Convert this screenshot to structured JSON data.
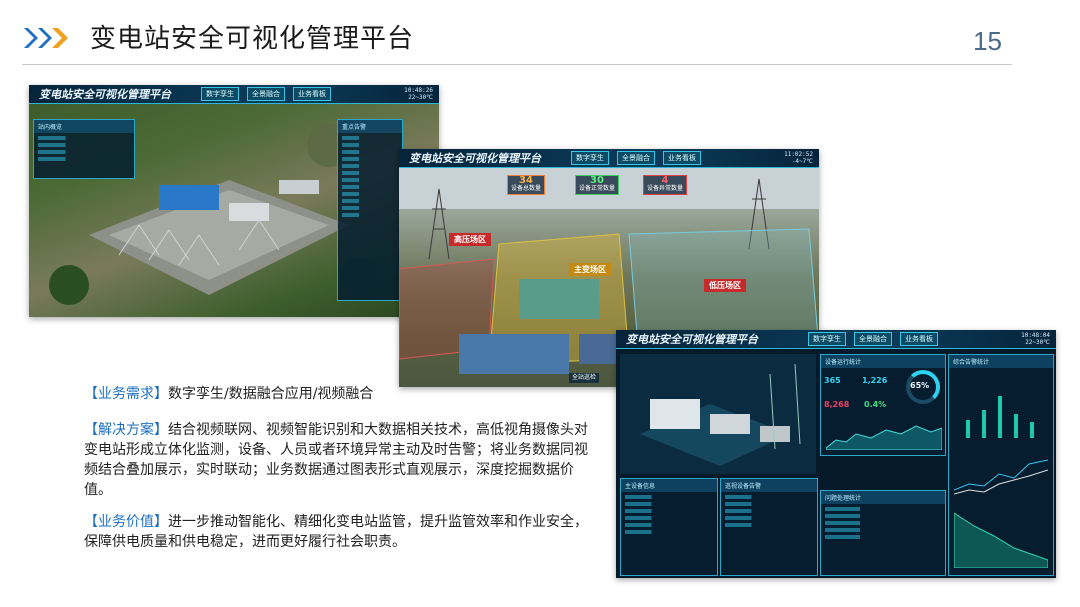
{
  "header": {
    "title": "变电站安全可视化管理平台",
    "page_number": "15",
    "accent_color": "#1e6fc0"
  },
  "screenshots": [
    {
      "title": "变电站安全可视化管理平台",
      "nav": [
        "数字孪生",
        "全景融合",
        "业务看板"
      ],
      "time": "10:48:26",
      "weather": "22~30℃",
      "panels": [
        "站内概览",
        "重点告警"
      ]
    },
    {
      "title": "变电站安全可视化管理平台",
      "nav": [
        "数字孪生",
        "全景融合",
        "业务看板"
      ],
      "time": "11:02:52",
      "weather": "-4~7℃",
      "stats": [
        {
          "value": "34",
          "label": "设备总数量"
        },
        {
          "value": "30",
          "label": "设备正常数量"
        },
        {
          "value": "4",
          "label": "设备异常数量"
        }
      ],
      "zones": [
        "高压场区",
        "主变场区",
        "低压场区"
      ],
      "footer": "全站巡检"
    },
    {
      "title": "变电站安全可视化管理平台",
      "nav": [
        "数字孪生",
        "全景融合",
        "业务看板"
      ],
      "time": "10:48:04",
      "weather": "22~30℃",
      "metrics": {
        "running_days": "365",
        "energy": "1,226",
        "load": "8,268",
        "percent": "65%",
        "rate": "0.4%"
      },
      "panel_titles": [
        "主设备信息",
        "巡视设备告警",
        "问题处理统计",
        "综合告警统计",
        "设备运行统计"
      ]
    }
  ],
  "sections": [
    {
      "label": "【业务需求】",
      "text": "数字孪生/数据融合应用/视频融合"
    },
    {
      "label": "【解决方案】",
      "text": "结合视频联网、视频智能识别和大数据相关技术，高低视角摄像头对变电站形成立体化监测，设备、人员或者环境异常主动及时告警；将业务数据同视频结合叠加展示，实时联动；业务数据通过图表形式直观展示，深度挖掘数据价值。"
    },
    {
      "label": "【业务价值】",
      "text": "进一步推动智能化、精细化变电站监管，提升监管效率和作业安全，保障供电质量和供电稳定，进而更好履行社会职责。"
    }
  ]
}
